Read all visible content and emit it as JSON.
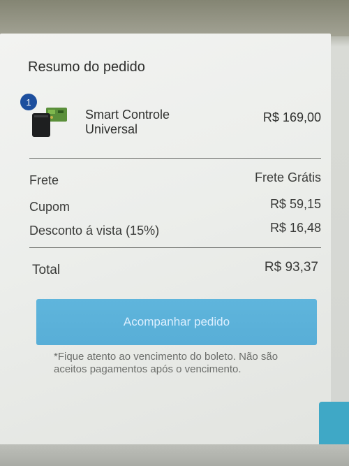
{
  "summary": {
    "title": "Resumo do pedido"
  },
  "product": {
    "quantity_badge": "1",
    "name": "Smart Controle Universal",
    "price": "R$ 169,00",
    "image_icon": "smart-remote-device-icon"
  },
  "rows": [
    {
      "label": "Frete",
      "value": "Frete Grátis"
    },
    {
      "label": "Cupom",
      "value": "R$ 59,15"
    },
    {
      "label": "Desconto á vista (15%)",
      "value": "R$ 16,48"
    }
  ],
  "total": {
    "label": "Total",
    "value": "R$ 93,37"
  },
  "track_button": {
    "label": "Acompanhar pedido"
  },
  "note": {
    "text": "*Fique atento ao vencimento do boleto. Não são aceitos pagamentos após o vencimento."
  },
  "colors": {
    "button": "#5fb5dc",
    "badge": "#1d4f9e",
    "side_widget": "#3fa8c6"
  }
}
